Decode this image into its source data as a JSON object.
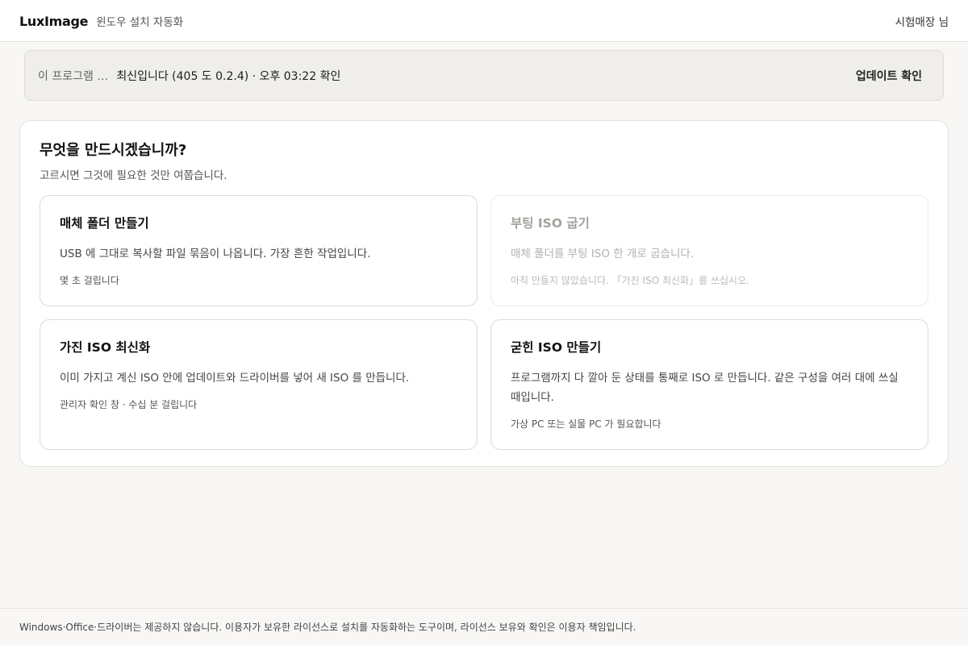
{
  "header": {
    "brand": "LuxImage",
    "subtitle": "윈도우 설치 자동화",
    "user": "시험매장 님"
  },
  "update_banner": {
    "label": "이 프로그램 …",
    "status": "최신입니다 (405 도 0.2.4) · 오후 03:22 확인",
    "button": "업데이트 확인"
  },
  "main": {
    "title": "무엇을 만드시겠습니까?",
    "description": "고르시면 그것에 필요한 것만 여쭙습니다.",
    "cards": [
      {
        "title": "매체 폴더 만들기",
        "description": "USB 에 그대로 복사할 파일 묶음이 나옵니다. 가장 흔한 작업입니다.",
        "note": "몇 초 걸립니다",
        "enabled": true
      },
      {
        "title": "부팅 ISO 굽기",
        "description": "매체 폴더를 부팅 ISO 한 개로 굽습니다.",
        "note": "아직 만들지 않았습니다. 「가진 ISO 최신화」를 쓰십시오.",
        "enabled": false
      },
      {
        "title": "가진 ISO 최신화",
        "description": "이미 가지고 계신 ISO 안에 업데이트와 드라이버를 넣어 새 ISO 를 만듭니다.",
        "note": "관리자 확인 창 · 수십 분 걸립니다",
        "enabled": true
      },
      {
        "title": "굳힌 ISO 만들기",
        "description": "프로그램까지 다 깔아 둔 상태를 통째로 ISO 로 만듭니다. 같은 구성을 여러 대에 쓰실 때입니다.",
        "note": "가상 PC 또는 실물 PC 가 필요합니다",
        "enabled": true
      }
    ]
  },
  "footer": {
    "text": "Windows·Office·드라이버는 제공하지 않습니다. 이용자가 보유한 라이선스로 설치를 자동화하는 도구이며, 라이선스 보유와 확인은 이용자 책임입니다."
  }
}
